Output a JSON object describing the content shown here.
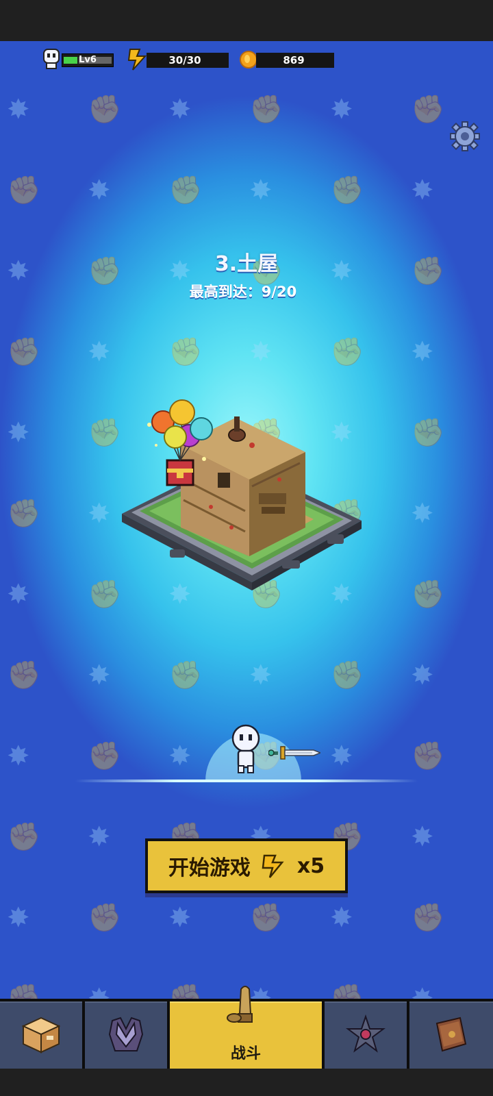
{
  "hud": {
    "level": "Lv6",
    "level_progress": 0.3,
    "energy": "30/30",
    "coins": "869"
  },
  "stage": {
    "title": "3.土屋",
    "best_reach": "最高到达：9/20"
  },
  "start_button": {
    "label": "开始游戏",
    "cost": "x5"
  },
  "nav": {
    "tabs": [
      {
        "icon": "crate-icon"
      },
      {
        "icon": "armor-icon"
      },
      {
        "icon": "bullet-icon",
        "label": "战斗",
        "active": true
      },
      {
        "icon": "talent-icon"
      },
      {
        "icon": "book-icon"
      }
    ]
  },
  "colors": {
    "accent_yellow": "#e9c23b",
    "nav_bg": "#3e4b6a",
    "bg_center": "#9af6fb",
    "bg_edge": "#2d53c9"
  }
}
